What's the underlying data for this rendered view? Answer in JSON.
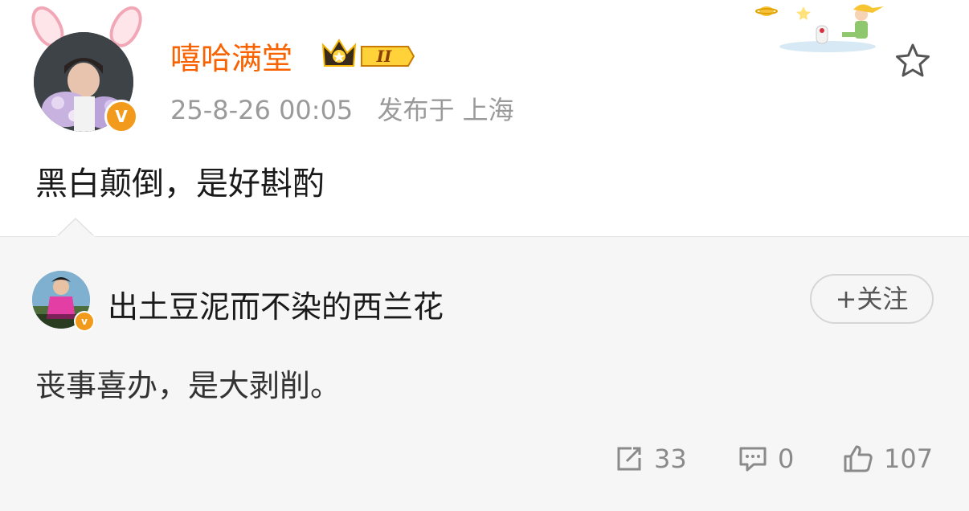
{
  "post": {
    "username": "嘻哈满堂",
    "vip_level": "II",
    "timestamp": "25-8-26 00:05",
    "location": "发布于 上海",
    "content": "黑白颠倒，是好斟酌",
    "verify_mark": "V"
  },
  "comment": {
    "username": "出土豆泥而不染的西兰花",
    "follow_label": "+关注",
    "content": "丧事喜办，是大剥削。",
    "verify_mark": "v",
    "repost_count": "33",
    "comment_count": "0",
    "like_count": "107"
  },
  "colors": {
    "username_accent": "#f86200",
    "meta_gray": "#9a9a9a",
    "comment_bg": "#f6f6f6",
    "badge_orange": "#f29a1b"
  }
}
